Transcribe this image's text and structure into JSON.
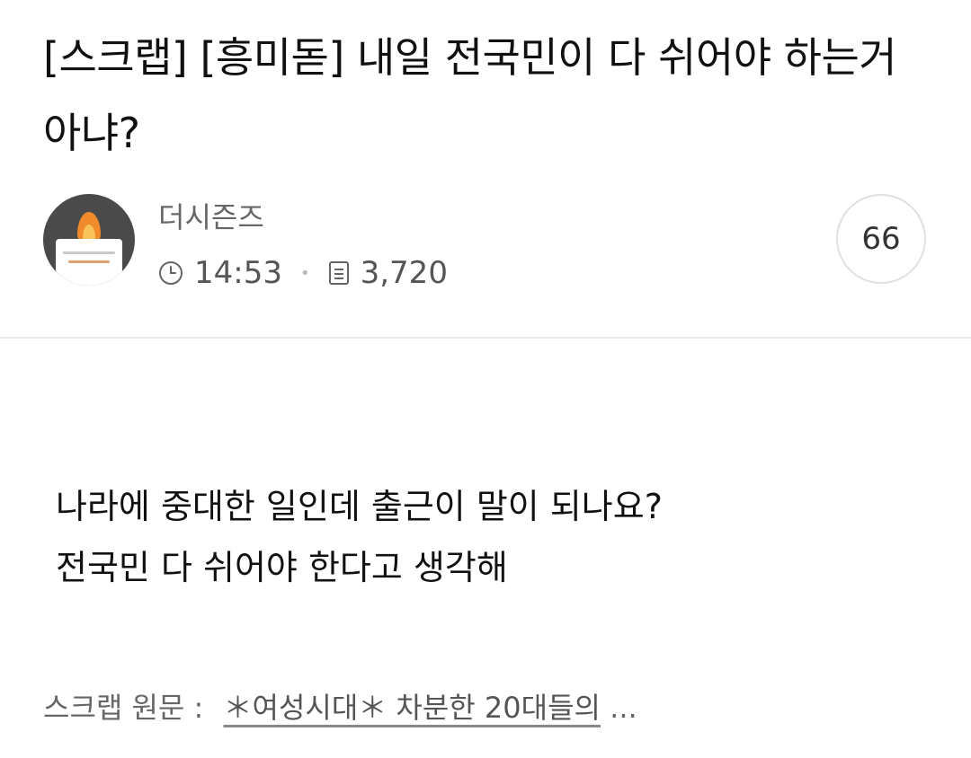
{
  "post": {
    "title": "[스크랩] [흥미돋] 내일 전국민이 다 쉬어야 하는거 아냐?",
    "author": "더시즌즈",
    "time": "14:53",
    "views": "3,720",
    "comment_count": "66",
    "body_lines": [
      "나라에 중대한 일인데 출근이 말이 되나요?",
      "전국민 다 쉬어야 한다고 생각해"
    ],
    "scrap_label": "스크랩 원문 :",
    "scrap_link_text": "＊여성시대＊ 차분한 20대들의",
    "scrap_link_ellipsis": "..."
  },
  "icons": {
    "avatar": "candle-cup-avatar",
    "time": "clock-icon",
    "views": "document-icon"
  },
  "colors": {
    "avatar_bg": "#4a4a4a",
    "flame": "#f08a2a",
    "meta_text": "#555555",
    "divider": "#e8e8e8"
  }
}
